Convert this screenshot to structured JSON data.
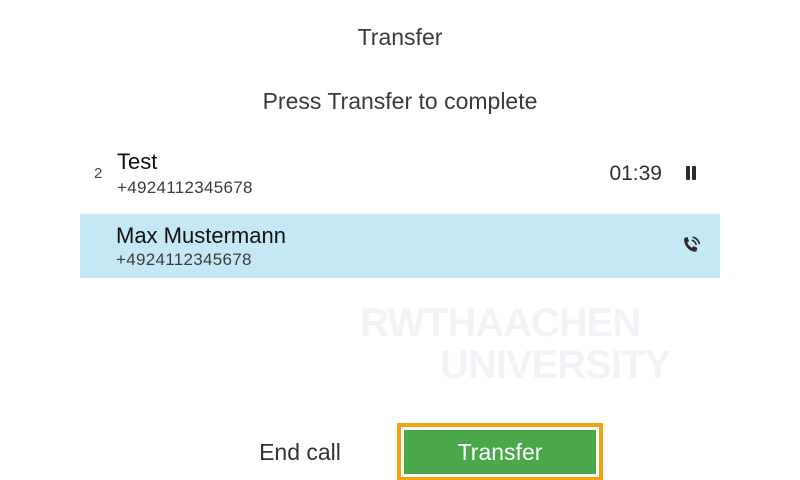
{
  "header": {
    "title": "Transfer",
    "instruction": "Press Transfer to complete"
  },
  "calls": [
    {
      "line_index": "2",
      "name": "Test",
      "number": "+4924112345678",
      "timer": "01:39",
      "state_icon": "pause-icon"
    },
    {
      "line_index": "",
      "name": "Max Mustermann",
      "number": "+4924112345678",
      "timer": "",
      "state_icon": "active-call-icon"
    }
  ],
  "watermark": {
    "line1": "RWTHAACHEN",
    "line2": "UNIVERSITY"
  },
  "actions": {
    "end_call_label": "End call",
    "transfer_label": "Transfer"
  },
  "colors": {
    "active_row": "#c5e8f6",
    "transfer_button": "#4aa84a",
    "focus_outline": "#f0a30a"
  }
}
